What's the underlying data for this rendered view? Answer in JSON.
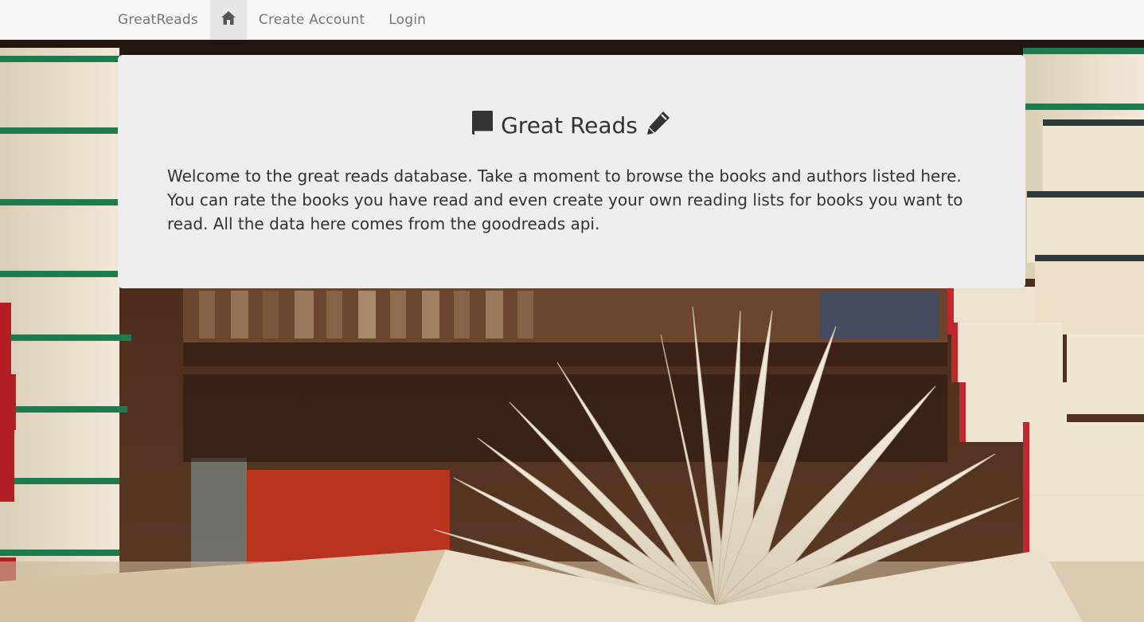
{
  "navbar": {
    "brand": "GreatReads",
    "home_icon": "home-icon",
    "links": [
      "Create Account",
      "Login"
    ]
  },
  "jumbotron": {
    "book_icon": "book-icon",
    "title": "Great Reads",
    "pencil_icon": "pencil-icon",
    "text": "Welcome to the great reads database. Take a moment to browse the books and authors listed here. You can rate the books you have read and even create your own reading lists for books you want to read. All the data here comes from the goodreads api."
  },
  "colors": {
    "navbar_bg": "#f8f8f8",
    "nav_text": "#777777",
    "nav_active_bg": "#e7e7e7",
    "jumbotron_bg": "#eeeeee",
    "text": "#333333"
  },
  "background": {
    "description_icon": "books-photo-background"
  }
}
